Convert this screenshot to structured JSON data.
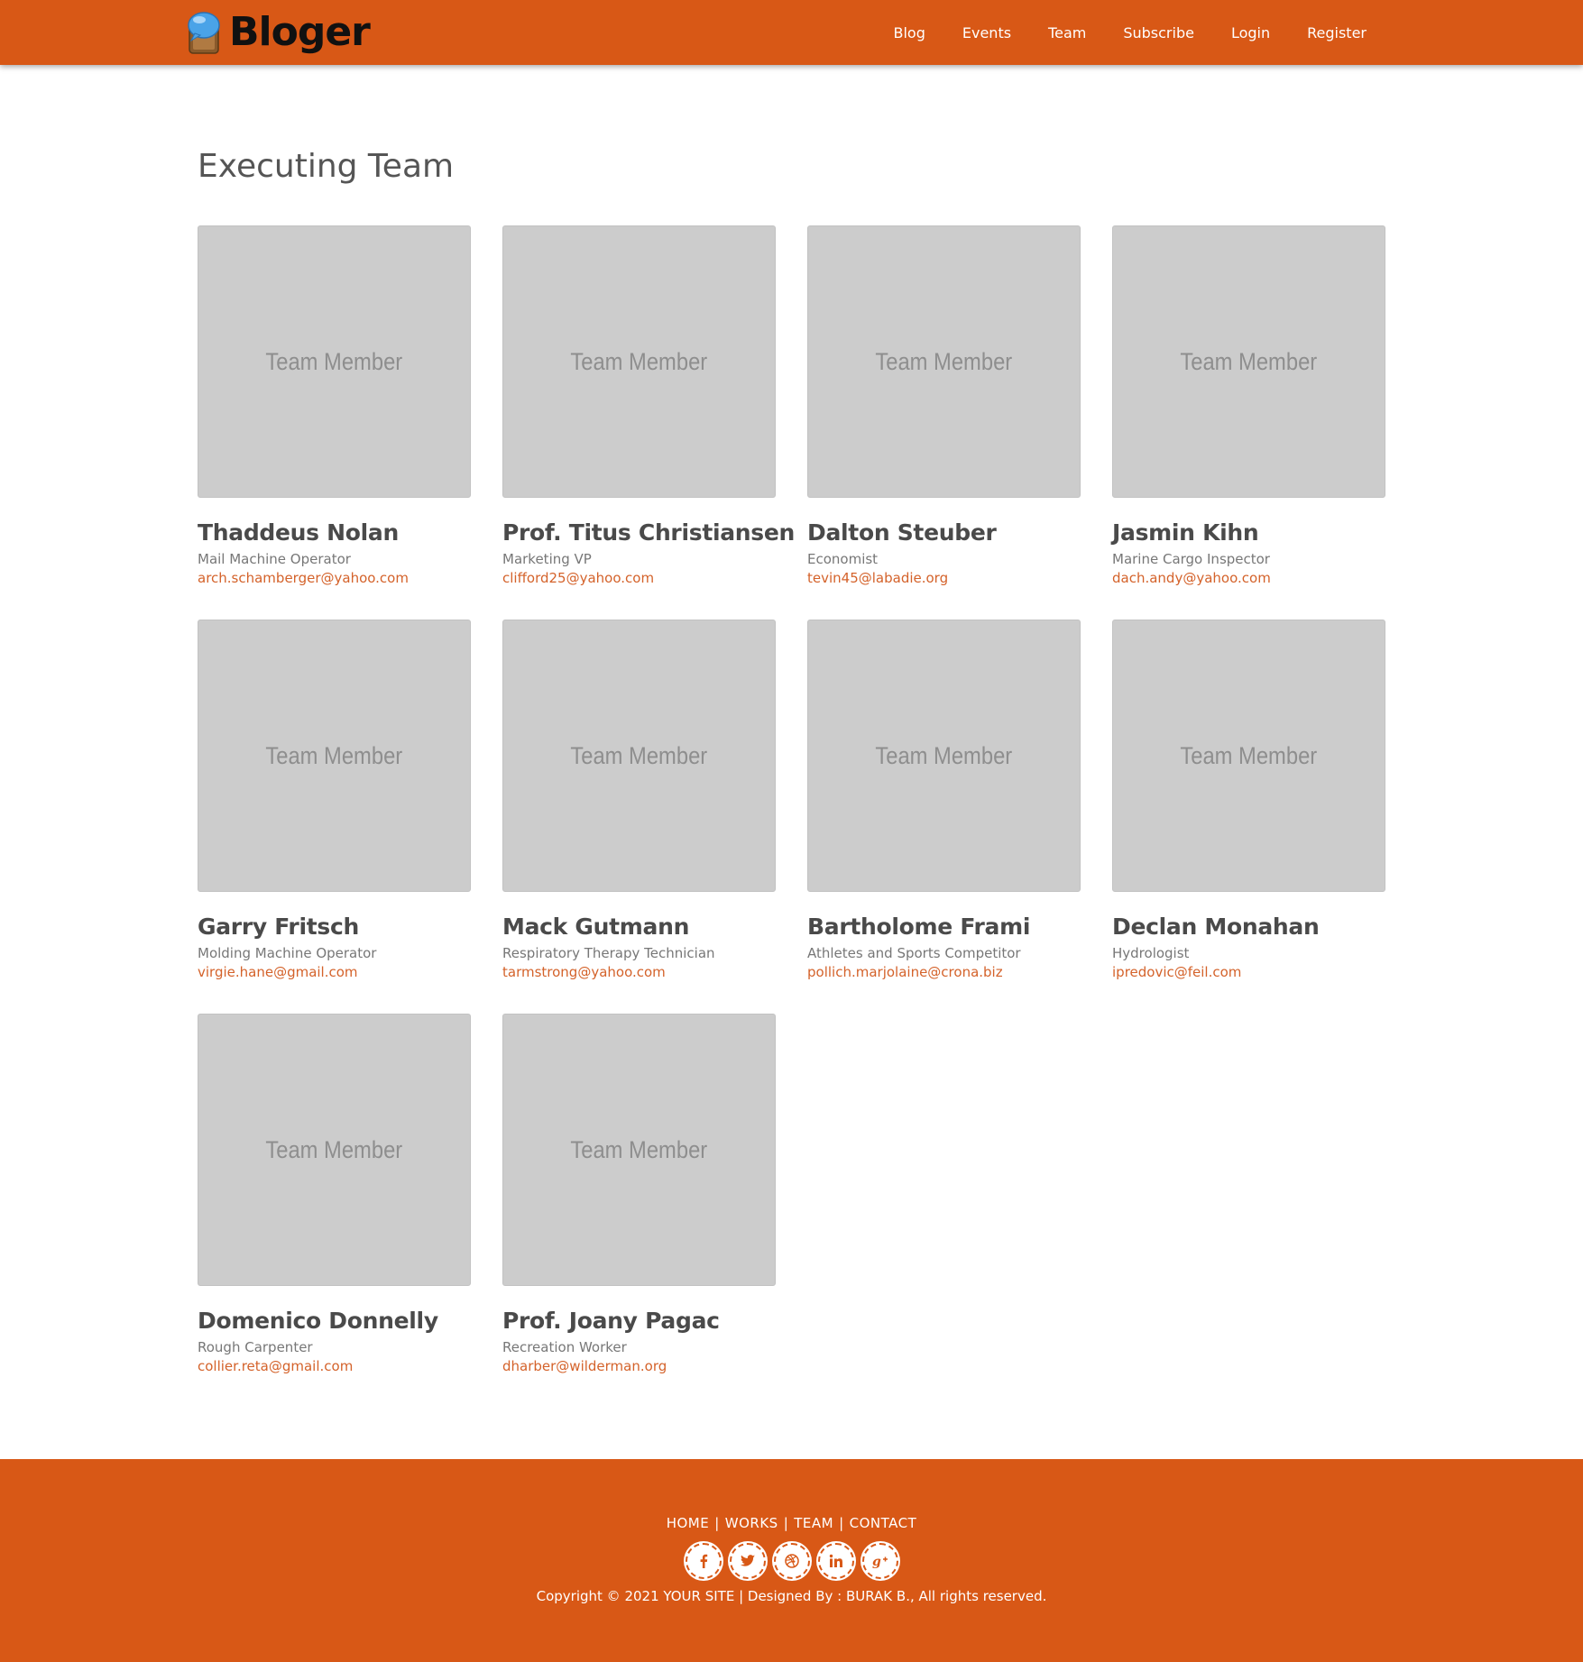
{
  "header": {
    "brand": "Bloger",
    "nav": [
      "Blog",
      "Events",
      "Team",
      "Subscribe",
      "Login",
      "Register"
    ]
  },
  "main": {
    "title": "Executing Team",
    "photo_placeholder": "Team Member",
    "members": [
      {
        "name": "Thaddeus Nolan",
        "role": "Mail Machine Operator",
        "email": "arch.schamberger@yahoo.com"
      },
      {
        "name": "Prof. Titus Christiansen",
        "role": "Marketing VP",
        "email": "clifford25@yahoo.com"
      },
      {
        "name": "Dalton Steuber",
        "role": "Economist",
        "email": "tevin45@labadie.org"
      },
      {
        "name": "Jasmin Kihn",
        "role": "Marine Cargo Inspector",
        "email": "dach.andy@yahoo.com"
      },
      {
        "name": "Garry Fritsch",
        "role": "Molding Machine Operator",
        "email": "virgie.hane@gmail.com"
      },
      {
        "name": "Mack Gutmann",
        "role": "Respiratory Therapy Technician",
        "email": "tarmstrong@yahoo.com"
      },
      {
        "name": "Bartholome Frami",
        "role": "Athletes and Sports Competitor",
        "email": "pollich.marjolaine@crona.biz"
      },
      {
        "name": "Declan Monahan",
        "role": "Hydrologist",
        "email": "ipredovic@feil.com"
      },
      {
        "name": "Domenico Donnelly",
        "role": "Rough Carpenter",
        "email": "collier.reta@gmail.com"
      },
      {
        "name": "Prof. Joany Pagac",
        "role": "Recreation Worker",
        "email": "dharber@wilderman.org"
      }
    ]
  },
  "footer": {
    "links": [
      "HOME",
      "WORKS",
      "TEAM",
      "CONTACT"
    ],
    "social": [
      "facebook-icon",
      "twitter-icon",
      "dribbble-icon",
      "linkedin-icon",
      "google-plus-icon"
    ],
    "copyright": "Copyright © 2021 YOUR SITE | Designed By : BURAK B., All rights reserved."
  },
  "colors": {
    "brand": "#d85816",
    "accent_text": "#d4622a",
    "placeholder": "#cccccc"
  }
}
